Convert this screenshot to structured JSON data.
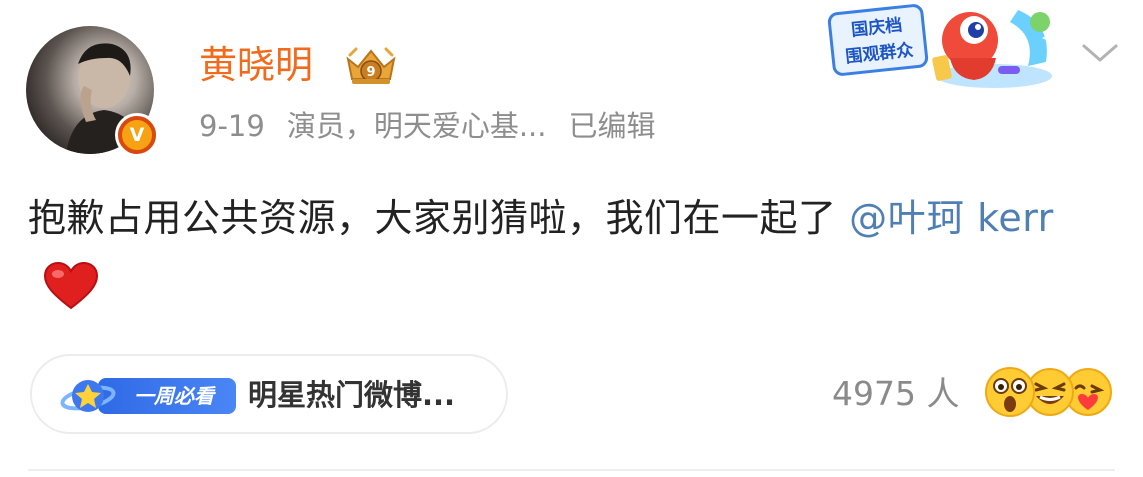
{
  "post": {
    "author": {
      "name": "黄晓明",
      "avatar_icon": "avatar-photo",
      "verified_mark": "V",
      "badge_icon": "crown-member-badge",
      "badge_level": "9"
    },
    "meta": {
      "date": "9-19",
      "description": "演员，明天爱心基...",
      "edited": "已编辑"
    },
    "content": {
      "text": "抱歉占用公共资源，大家别猜啦，我们在一起了 ",
      "mention": "@叶珂 kerr",
      "emoji_icon": "red-heart-icon"
    },
    "promo_sticker": {
      "line1": "国庆档",
      "line2": "围观群众"
    },
    "topic_pill": {
      "tag_label": "一周必看",
      "text": "明星热门微博..."
    },
    "reactions": {
      "count": "4975 人",
      "emoji_icons": [
        "shocked-face-icon",
        "laughing-face-icon",
        "blowing-kiss-face-icon"
      ]
    },
    "colors": {
      "username": "#f26a1b",
      "mention": "#4f7fb3",
      "meta": "#8e8e8e",
      "verified_badge": "#f6a212"
    }
  }
}
